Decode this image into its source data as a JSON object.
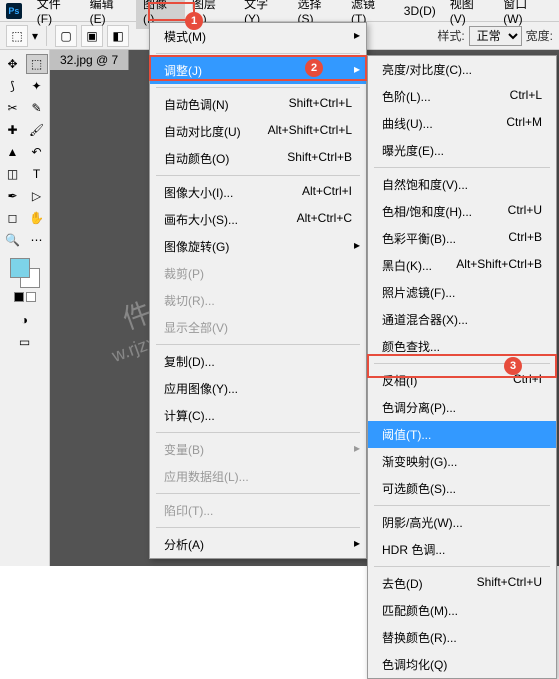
{
  "menubar": {
    "items": [
      "文件(F)",
      "编辑(E)",
      "图像(I)",
      "图层(L)",
      "文字(Y)",
      "选择(S)",
      "滤镜(T)",
      "3D(D)",
      "视图(V)",
      "窗口(W)"
    ],
    "activeIndex": 2
  },
  "badges": {
    "b1": "1",
    "b2": "2",
    "b3": "3"
  },
  "toolbar": {
    "styleLabel": "样式:",
    "styleValue": "正常",
    "widthLabel": "宽度:"
  },
  "tab": {
    "name": "32.jpg @ 7"
  },
  "dropdown1": [
    {
      "label": "模式(M)",
      "arrow": true
    },
    {
      "sep": true
    },
    {
      "label": "调整(J)",
      "arrow": true,
      "hot": true
    },
    {
      "sep": true
    },
    {
      "label": "自动色调(N)",
      "sc": "Shift+Ctrl+L"
    },
    {
      "label": "自动对比度(U)",
      "sc": "Alt+Shift+Ctrl+L"
    },
    {
      "label": "自动颜色(O)",
      "sc": "Shift+Ctrl+B"
    },
    {
      "sep": true
    },
    {
      "label": "图像大小(I)...",
      "sc": "Alt+Ctrl+I"
    },
    {
      "label": "画布大小(S)...",
      "sc": "Alt+Ctrl+C"
    },
    {
      "label": "图像旋转(G)",
      "arrow": true
    },
    {
      "label": "裁剪(P)",
      "disabled": true
    },
    {
      "label": "裁切(R)...",
      "disabled": true
    },
    {
      "label": "显示全部(V)",
      "disabled": true
    },
    {
      "sep": true
    },
    {
      "label": "复制(D)..."
    },
    {
      "label": "应用图像(Y)..."
    },
    {
      "label": "计算(C)..."
    },
    {
      "sep": true
    },
    {
      "label": "变量(B)",
      "arrow": true,
      "disabled": true
    },
    {
      "label": "应用数据组(L)...",
      "disabled": true
    },
    {
      "sep": true
    },
    {
      "label": "陷印(T)...",
      "disabled": true
    },
    {
      "sep": true
    },
    {
      "label": "分析(A)",
      "arrow": true
    }
  ],
  "dropdown2": [
    {
      "label": "亮度/对比度(C)..."
    },
    {
      "label": "色阶(L)...",
      "sc": "Ctrl+L"
    },
    {
      "label": "曲线(U)...",
      "sc": "Ctrl+M"
    },
    {
      "label": "曝光度(E)..."
    },
    {
      "sep": true
    },
    {
      "label": "自然饱和度(V)..."
    },
    {
      "label": "色相/饱和度(H)...",
      "sc": "Ctrl+U"
    },
    {
      "label": "色彩平衡(B)...",
      "sc": "Ctrl+B"
    },
    {
      "label": "黑白(K)...",
      "sc": "Alt+Shift+Ctrl+B"
    },
    {
      "label": "照片滤镜(F)..."
    },
    {
      "label": "通道混合器(X)..."
    },
    {
      "label": "颜色查找..."
    },
    {
      "sep": true
    },
    {
      "label": "反相(I)",
      "sc": "Ctrl+I"
    },
    {
      "label": "色调分离(P)..."
    },
    {
      "label": "阈值(T)...",
      "hot": true
    },
    {
      "label": "渐变映射(G)..."
    },
    {
      "label": "可选颜色(S)..."
    },
    {
      "sep": true
    },
    {
      "label": "阴影/高光(W)..."
    },
    {
      "label": "HDR 色调..."
    },
    {
      "sep": true
    },
    {
      "label": "去色(D)",
      "sc": "Shift+Ctrl+U"
    },
    {
      "label": "匹配颜色(M)..."
    },
    {
      "label": "替换颜色(R)..."
    },
    {
      "label": "色调均化(Q)"
    }
  ],
  "watermark1": "件自学网",
  "watermark2": "w.rjzxw.com"
}
